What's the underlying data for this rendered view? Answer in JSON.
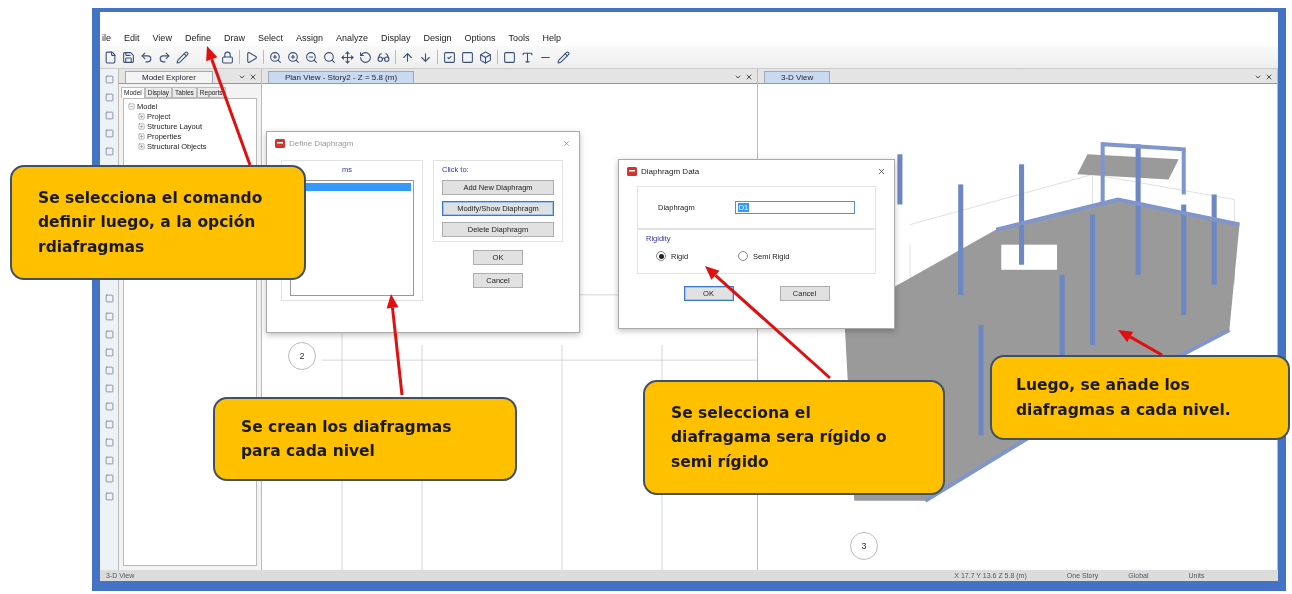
{
  "menu_bar": [
    {
      "label": "ile"
    },
    {
      "label": "Edit"
    },
    {
      "label": "View"
    },
    {
      "label": "Define"
    },
    {
      "label": "Draw"
    },
    {
      "label": "Select"
    },
    {
      "label": "Assign"
    },
    {
      "label": "Analyze"
    },
    {
      "label": "Display"
    },
    {
      "label": "Design"
    },
    {
      "label": "Options"
    },
    {
      "label": "Tools"
    },
    {
      "label": "Help"
    }
  ],
  "model_explorer": {
    "title": "Model Explorer",
    "tabs": [
      {
        "label": "Model",
        "selected": true
      },
      {
        "label": "Display",
        "selected": false
      },
      {
        "label": "Tables",
        "selected": false
      },
      {
        "label": "Reports",
        "selected": false
      }
    ],
    "tree": [
      {
        "label": "Model",
        "expanded": true,
        "children": [
          {
            "label": "Project",
            "expanded": false
          },
          {
            "label": "Structure Layout",
            "expanded": false
          },
          {
            "label": "Properties",
            "expanded": false
          },
          {
            "label": "Structural Objects",
            "expanded": false
          }
        ]
      }
    ]
  },
  "plan_view": {
    "tab": "Plan View - Story2 - Z = 5.8 (m)",
    "grid_bubbles": [
      "2"
    ]
  },
  "define_diaphragm": {
    "title": "Define Diaphragm",
    "list_label": "ms",
    "list_row_selected": true,
    "click_to_label": "Click to:",
    "buttons": [
      {
        "label": "Add New Diaphragm",
        "focused": false
      },
      {
        "label": "Modify/Show Diaphragm",
        "focused": true
      },
      {
        "label": "Delete Diaphragm",
        "focused": false
      }
    ],
    "ok": "OK",
    "cancel": "Cancel"
  },
  "diaphragm_data": {
    "title": "Diaphragm Data",
    "field_label": "Diaphragm",
    "value": "D1",
    "rigidity_label": "Rigidity",
    "options": [
      {
        "label": "Rigid",
        "selected": true
      },
      {
        "label": "Semi Rigid",
        "selected": false
      }
    ],
    "buttons": [
      {
        "label": "OK",
        "focused": true
      },
      {
        "label": "Cancel",
        "focused": false
      }
    ]
  },
  "three_d_view": {
    "tab": "3-D View",
    "grid_bubbles": [
      "3"
    ]
  },
  "status_bar": {
    "view": "3-D View",
    "coordinates": "X 17.7  Y 13.6  Z 5.8 (m)",
    "story": "One Story",
    "system": "Global",
    "units": "Units"
  },
  "callouts": [
    {
      "text": "Se selecciona el comando\ndefinir luego, a la opción\nrdiafragmas"
    },
    {
      "text": "Se crean los diafragmas\npara cada nivel"
    },
    {
      "text": "Se selecciona el\ndiafragama sera rígido o\nsemi rígido"
    },
    {
      "text": "Luego, se añade los\ndiafragmas a cada nivel."
    }
  ]
}
